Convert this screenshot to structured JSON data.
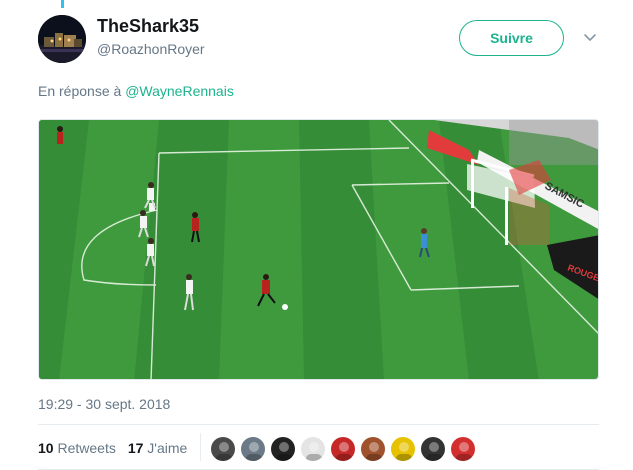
{
  "tweet": {
    "display_name": "TheShark35",
    "handle": "@RoazhonRoyer",
    "reply_prefix": "En réponse à",
    "reply_to": "@WayneRennais",
    "timestamp": "19:29 - 30 sept. 2018"
  },
  "follow": {
    "label": "Suivre"
  },
  "stats": {
    "retweets_count": "10",
    "retweets_label": "Retweets",
    "likes_count": "17",
    "likes_label": "J'aime"
  },
  "media": {
    "banner_text": "SAMSIC",
    "board_text": "ROUGE"
  },
  "colors": {
    "accent": "#1db38e",
    "pitch_light": "#3f9a3e",
    "pitch_dark": "#348a35"
  },
  "likers": [
    {
      "icon": "avatar-portrait-icon",
      "color": "#4a4a4a"
    },
    {
      "icon": "avatar-stadium-icon",
      "color": "#6b7a86"
    },
    {
      "icon": "avatar-logo-icon",
      "color": "#222222"
    },
    {
      "icon": "avatar-crest-icon",
      "color": "#e4e4e4"
    },
    {
      "icon": "avatar-red-icon",
      "color": "#c62828"
    },
    {
      "icon": "avatar-player-icon",
      "color": "#a0522d"
    },
    {
      "icon": "avatar-yellow-icon",
      "color": "#e6c200"
    },
    {
      "icon": "avatar-dark-icon",
      "color": "#333333"
    },
    {
      "icon": "avatar-jersey-icon",
      "color": "#d32f2f"
    }
  ]
}
